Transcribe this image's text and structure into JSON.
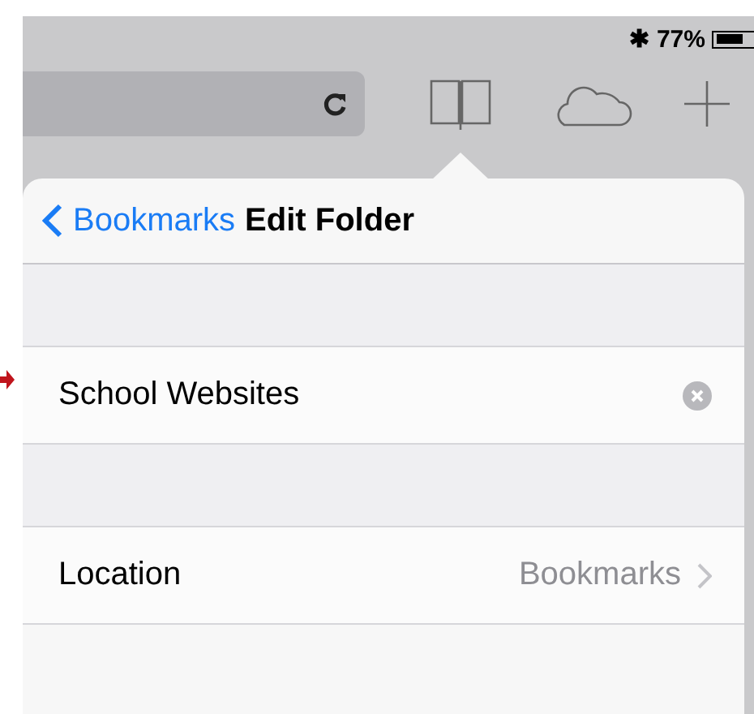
{
  "status_bar": {
    "bluetooth": "✱",
    "battery_percent": "77%"
  },
  "popover": {
    "back_label": "Bookmarks",
    "title": "Edit Folder",
    "rows": [
      {
        "kind": "field",
        "value": "School Websites"
      },
      {
        "kind": "link",
        "label": "Location",
        "value": "Bookmarks"
      }
    ]
  }
}
